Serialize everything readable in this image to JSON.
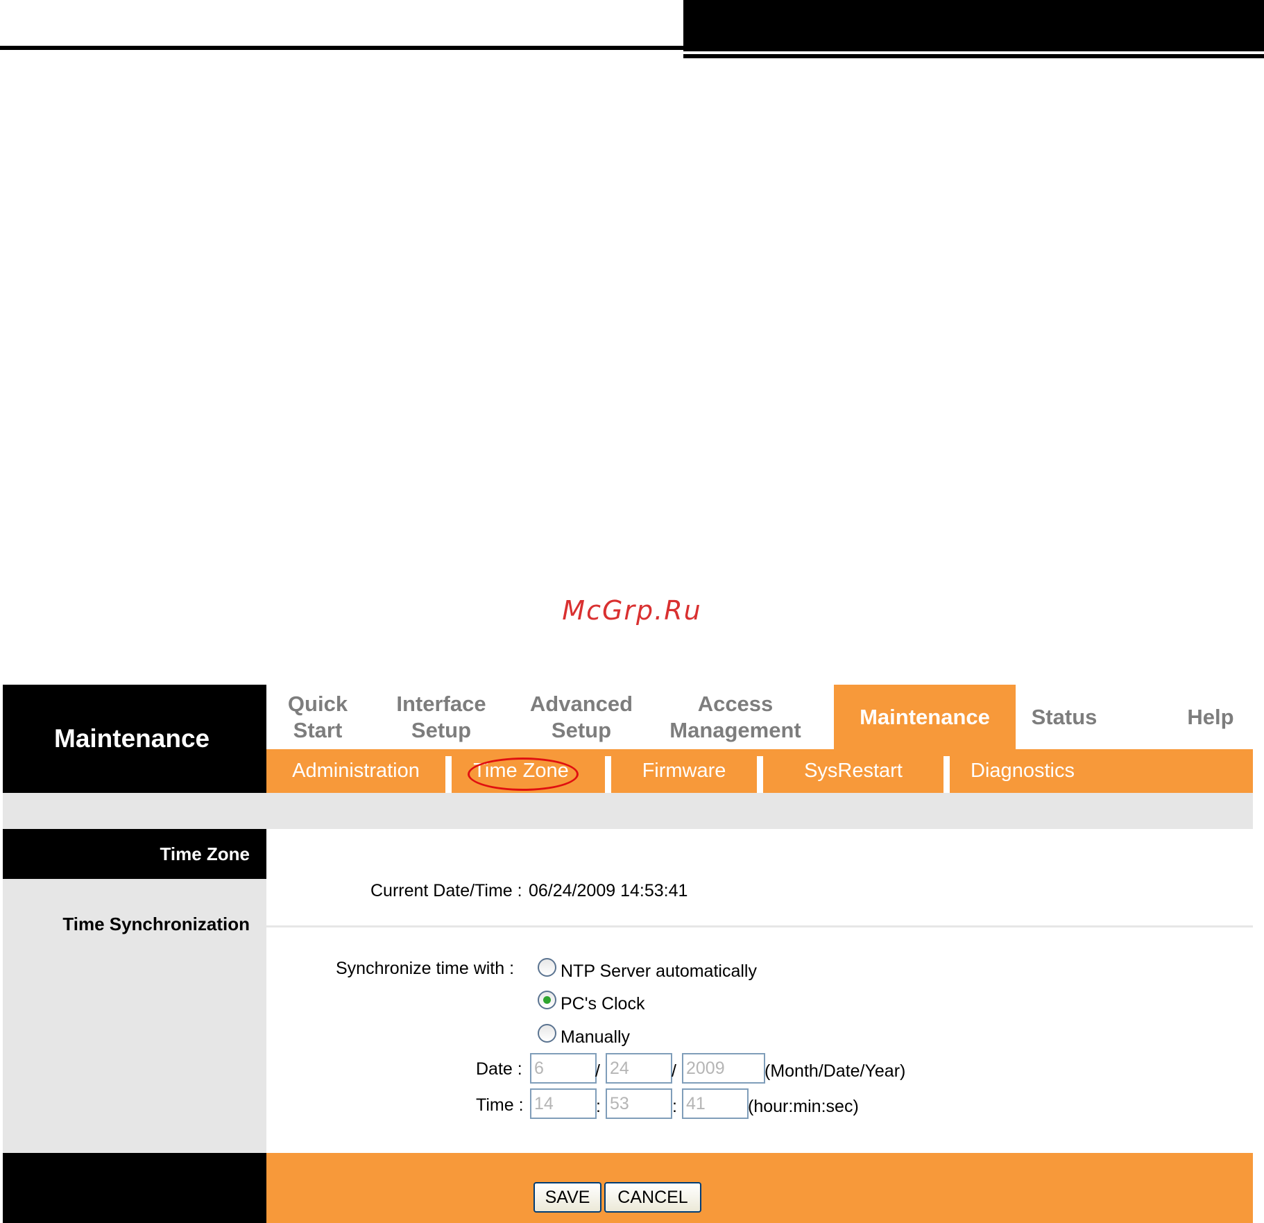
{
  "watermark": "McGrp.Ru",
  "section_title": "Maintenance",
  "main_nav": [
    {
      "line1": "Quick",
      "line2": "Start"
    },
    {
      "line1": "Interface",
      "line2": "Setup"
    },
    {
      "line1": "Advanced",
      "line2": "Setup"
    },
    {
      "line1": "Access",
      "line2": "Management"
    },
    {
      "line1": "Maintenance",
      "line2": "",
      "active": true
    },
    {
      "line1": "Status",
      "line2": ""
    },
    {
      "line1": "Help",
      "line2": ""
    }
  ],
  "sub_nav": [
    "Administration",
    "Time Zone",
    "Firmware",
    "SysRestart",
    "Diagnostics"
  ],
  "sidebar": {
    "time_zone": "Time Zone",
    "time_sync": "Time Synchronization"
  },
  "current": {
    "label": "Current Date/Time :",
    "value": "06/24/2009 14:53:41"
  },
  "sync": {
    "label": "Synchronize time with :",
    "options": [
      "NTP Server automatically",
      "PC's Clock",
      "Manually"
    ],
    "selected": "PC's Clock"
  },
  "date": {
    "label": "Date :",
    "month": "6",
    "day": "24",
    "year": "2009",
    "sep": "/",
    "hint": "(Month/Date/Year)"
  },
  "time": {
    "label": "Time :",
    "hour": "14",
    "min": "53",
    "sec": "41",
    "sep": ":",
    "hint": "(hour:min:sec)"
  },
  "buttons": {
    "save": "SAVE",
    "cancel": "CANCEL"
  }
}
